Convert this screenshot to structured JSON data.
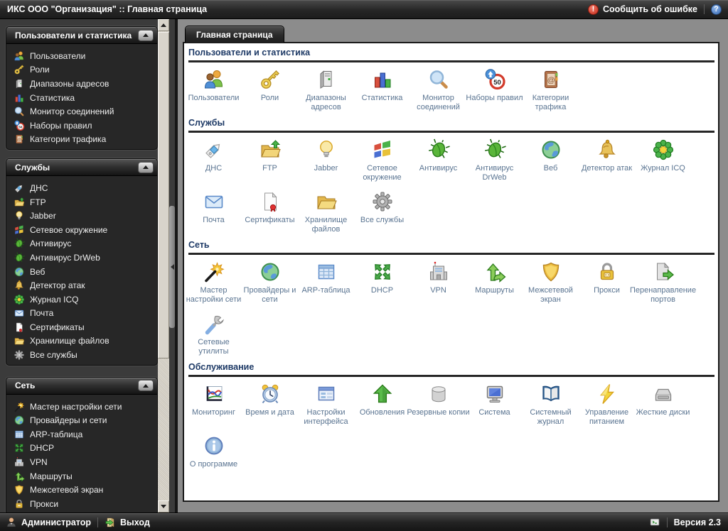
{
  "topbar": {
    "title": "ИКС ООО \"Организация\"  :: Главная страница",
    "report_error": "Сообщить об ошибке"
  },
  "tab": {
    "label": "Главная страница"
  },
  "sidebar": {
    "panels": [
      {
        "title": "Пользователи и статистика",
        "items": [
          {
            "icon": "users-icon",
            "label": "Пользователи"
          },
          {
            "icon": "key-icon",
            "label": "Роли"
          },
          {
            "icon": "server-icon",
            "label": "Диапазоны адресов"
          },
          {
            "icon": "stats-icon",
            "label": "Статистика"
          },
          {
            "icon": "monitor-icon",
            "label": "Монитор соединений"
          },
          {
            "icon": "rules-icon",
            "label": "Наборы правил"
          },
          {
            "icon": "traffic-icon",
            "label": "Категории трафика"
          }
        ]
      },
      {
        "title": "Службы",
        "items": [
          {
            "icon": "dns-icon",
            "label": "ДНС"
          },
          {
            "icon": "ftp-icon",
            "label": "FTP"
          },
          {
            "icon": "jabber-icon",
            "label": "Jabber"
          },
          {
            "icon": "network-icon",
            "label": "Сетевое окружение"
          },
          {
            "icon": "antivirus-icon",
            "label": "Антивирус"
          },
          {
            "icon": "antivirus-icon",
            "label": "Антивирус DrWeb"
          },
          {
            "icon": "web-icon",
            "label": "Веб"
          },
          {
            "icon": "attacks-icon",
            "label": "Детектор атак"
          },
          {
            "icon": "icq-icon",
            "label": "Журнал ICQ"
          },
          {
            "icon": "mail-icon",
            "label": "Почта"
          },
          {
            "icon": "cert-icon",
            "label": "Сертификаты"
          },
          {
            "icon": "storage-icon",
            "label": "Хранилище файлов"
          },
          {
            "icon": "services-icon",
            "label": "Все службы"
          }
        ]
      },
      {
        "title": "Сеть",
        "items": [
          {
            "icon": "wizard-icon",
            "label": "Мастер настройки сети"
          },
          {
            "icon": "providers-icon",
            "label": "Провайдеры и сети"
          },
          {
            "icon": "arp-icon",
            "label": "ARP-таблица"
          },
          {
            "icon": "dhcp-icon",
            "label": "DHCP"
          },
          {
            "icon": "vpn-icon",
            "label": "VPN"
          },
          {
            "icon": "routes-icon",
            "label": "Маршруты"
          },
          {
            "icon": "firewall-icon",
            "label": "Межсетевой экран"
          },
          {
            "icon": "proxy-icon",
            "label": "Прокси"
          }
        ]
      }
    ]
  },
  "main": {
    "sections": [
      {
        "title": "Пользователи и статистика",
        "items": [
          {
            "icon": "users-icon",
            "label": "Пользователи"
          },
          {
            "icon": "key-icon",
            "label": "Роли"
          },
          {
            "icon": "server-icon",
            "label": "Диапазоны\nадресов"
          },
          {
            "icon": "stats-icon",
            "label": "Статистика"
          },
          {
            "icon": "monitor-icon",
            "label": "Монитор\nсоединений"
          },
          {
            "icon": "rules-icon",
            "label": "Наборы правил"
          },
          {
            "icon": "traffic-icon",
            "label": "Категории\nтрафика"
          }
        ]
      },
      {
        "title": "Службы",
        "items": [
          {
            "icon": "dns-icon",
            "label": "ДНС"
          },
          {
            "icon": "ftp-icon",
            "label": "FTP"
          },
          {
            "icon": "jabber-icon",
            "label": "Jabber"
          },
          {
            "icon": "network-icon",
            "label": "Сетевое\nокружение"
          },
          {
            "icon": "antivirus-icon",
            "label": "Антивирус"
          },
          {
            "icon": "antivirus-icon",
            "label": "Антивирус\nDrWeb"
          },
          {
            "icon": "web-icon",
            "label": "Веб"
          },
          {
            "icon": "attacks-icon",
            "label": "Детектор атак"
          },
          {
            "icon": "icq-icon",
            "label": "Журнал ICQ"
          },
          {
            "icon": "mail-icon",
            "label": "Почта"
          },
          {
            "icon": "cert-icon",
            "label": "Сертификаты"
          },
          {
            "icon": "storage-icon",
            "label": "Хранилище\nфайлов"
          },
          {
            "icon": "services-icon",
            "label": "Все службы"
          }
        ]
      },
      {
        "title": "Сеть",
        "items": [
          {
            "icon": "wizard-icon",
            "label": "Мастер\nнастройки сети"
          },
          {
            "icon": "providers-icon",
            "label": "Провайдеры и\nсети"
          },
          {
            "icon": "arp-icon",
            "label": "ARP-таблица"
          },
          {
            "icon": "dhcp-icon",
            "label": "DHCP"
          },
          {
            "icon": "vpn-icon",
            "label": "VPN"
          },
          {
            "icon": "routes-icon",
            "label": "Маршруты"
          },
          {
            "icon": "firewall-icon",
            "label": "Межсетевой\nэкран"
          },
          {
            "icon": "proxy-icon",
            "label": "Прокси"
          },
          {
            "icon": "portforward-icon",
            "label": "Перенаправление\nпортов"
          },
          {
            "icon": "netutils-icon",
            "label": "Сетевые\nутилиты"
          }
        ]
      },
      {
        "title": "Обслуживание",
        "items": [
          {
            "icon": "monitoring-icon",
            "label": "Мониторинг"
          },
          {
            "icon": "time-icon",
            "label": "Время и дата"
          },
          {
            "icon": "ui-icon",
            "label": "Настройки\nинтерфейса"
          },
          {
            "icon": "updates-icon",
            "label": "Обновления"
          },
          {
            "icon": "backup-icon",
            "label": "Резервные копии"
          },
          {
            "icon": "system-icon",
            "label": "Система"
          },
          {
            "icon": "journal-icon",
            "label": "Системный\nжурнал"
          },
          {
            "icon": "power-icon",
            "label": "Управление\nпитанием"
          },
          {
            "icon": "disks-icon",
            "label": "Жесткие диски"
          },
          {
            "icon": "about-icon",
            "label": "О программе"
          }
        ]
      }
    ]
  },
  "bottombar": {
    "user": "Администратор",
    "logout": "Выход",
    "version": "Версия 2.3"
  },
  "colors": {
    "accent_title": "#1e3a66",
    "label": "#5a7491",
    "error_badge": "#c52e1c",
    "help_badge": "#3a6cb4"
  }
}
